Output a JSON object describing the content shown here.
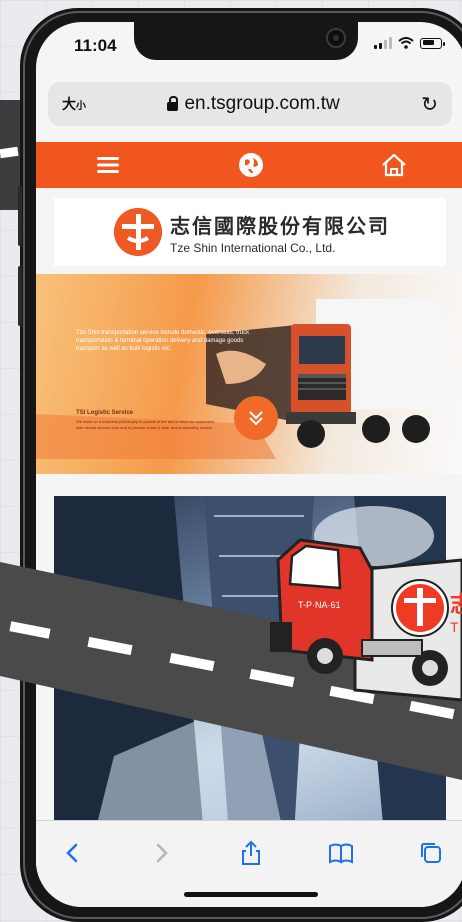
{
  "status_bar": {
    "time": "11:04"
  },
  "browser": {
    "text_size_label": "大",
    "text_size_small": "小",
    "url": "en.tsgroup.com.tw",
    "reload_icon": "reload-icon"
  },
  "site_nav": {
    "background": "#f0561d",
    "items": [
      {
        "icon": "menu-icon"
      },
      {
        "icon": "globe-icon"
      },
      {
        "icon": "home-icon"
      }
    ]
  },
  "logo": {
    "chinese_name": "志信國際股份有限公司",
    "english_name": "Tze Shin International Co., Ltd."
  },
  "hero": {
    "description": "Tze Shin transportation service include domestic, overseas, truck transportation & terminal operation delivery and damage goods transport as well as bulk logistic etc.",
    "title": "TSI Logistic Service",
    "subtitle": "We insist on a business philosophy in pursuit of the aim to treat our customers with utmost sincere care and to provide a fast & safe, and trustworthy service."
  },
  "truck_graphic": {
    "plate": "T-P·NA·61",
    "logo_char": "志",
    "logo_letters": "T"
  },
  "toolbar": {
    "items": [
      "back-icon",
      "forward-icon",
      "share-icon",
      "bookmarks-icon",
      "tabs-icon"
    ]
  },
  "colors": {
    "brand_orange": "#ef5a24",
    "ios_blue": "#1a73e8",
    "road": "#4a4a4a"
  }
}
